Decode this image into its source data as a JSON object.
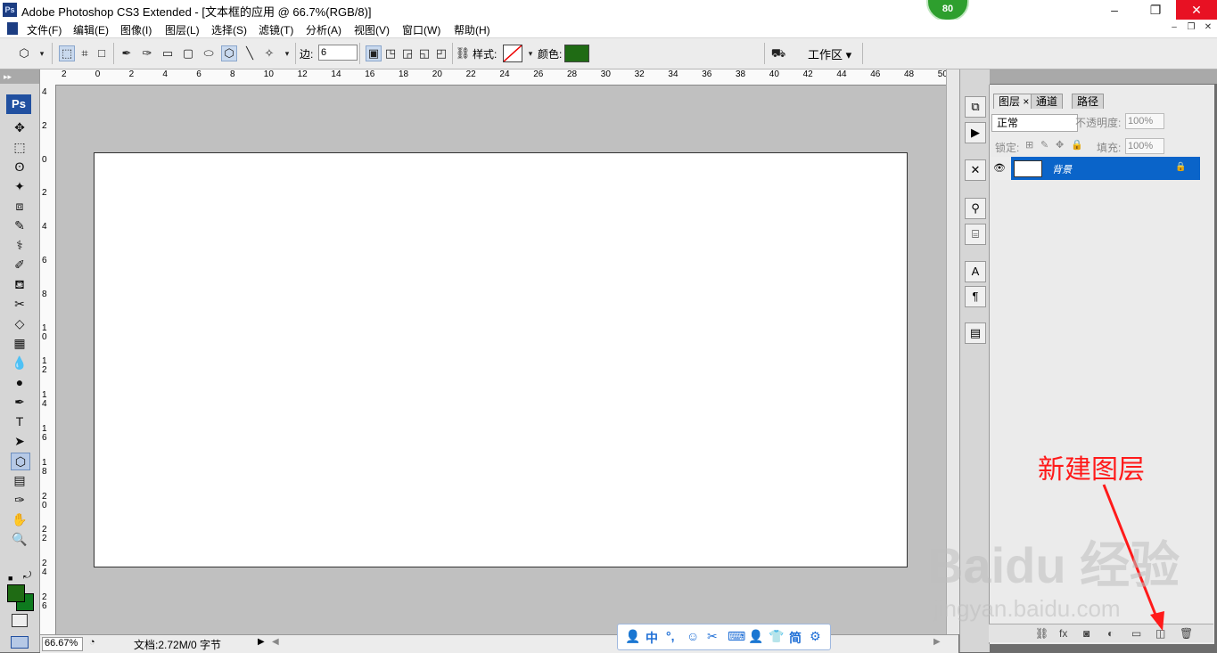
{
  "window": {
    "app_icon": "Ps",
    "title": "Adobe Photoshop CS3 Extended - [文本框的应用 @ 66.7%(RGB/8)]",
    "badge": "80",
    "min_icon": "–",
    "max_icon": "❐",
    "close_icon": "✕"
  },
  "menu": {
    "items": [
      "文件(F)",
      "编辑(E)",
      "图像(I)",
      "图层(L)",
      "选择(S)",
      "滤镜(T)",
      "分析(A)",
      "视图(V)",
      "窗口(W)",
      "帮助(H)"
    ],
    "doc_controls": [
      "–",
      "❐",
      "✕"
    ]
  },
  "options": {
    "sides_label": "边:",
    "sides_value": "6",
    "style_label": "样式:",
    "color_label": "颜色:",
    "color_value": "#1f6b14",
    "workspace_label": "工作区 ▾"
  },
  "toolbox": {
    "header": "▸▸",
    "logo": "Ps",
    "tools": [
      "✥",
      "⬚",
      "ʘ",
      "✦",
      "⧈",
      "✎",
      "⚕",
      "✐",
      "⛾",
      "✂",
      "◇",
      "▦",
      "💧",
      "●",
      "✒",
      "T",
      "➤",
      "⬡",
      "▤",
      "✑",
      "✋",
      "🔍"
    ],
    "fg_color": "#1f6b14",
    "bg_color": "#0e7a1e"
  },
  "rulers": {
    "h_labels": [
      "2",
      "0",
      "2",
      "4",
      "6",
      "8",
      "10",
      "12",
      "14",
      "16",
      "18",
      "20",
      "22",
      "24",
      "26",
      "28",
      "30",
      "32",
      "34",
      "36",
      "38",
      "40",
      "42",
      "44",
      "46",
      "48",
      "50"
    ],
    "v_labels": [
      "4",
      "2",
      "0",
      "2",
      "4",
      "6",
      "8",
      "10",
      "12",
      "14",
      "16",
      "18",
      "20",
      "22",
      "24",
      "26"
    ]
  },
  "status": {
    "zoom": "66.67%",
    "doc_info": "文档:2.72M/0 字节"
  },
  "ime": {
    "items": [
      "👤",
      "中",
      "°,",
      "☺",
      "✂",
      "⌨",
      "👤",
      "👕",
      "简",
      "⚙"
    ]
  },
  "dock": {
    "icons": [
      "⧉",
      "▶",
      "✕",
      "⚲",
      "⌸",
      "A",
      "¶",
      "▤"
    ]
  },
  "layers": {
    "tabs": [
      "图层 ×",
      "通道",
      "路径"
    ],
    "blend_mode": "正常",
    "opacity_label": "不透明度:",
    "opacity_value": "100%",
    "lock_label": "锁定:",
    "fill_label": "填充:",
    "fill_value": "100%",
    "layer_name": "背景",
    "footer_icons": [
      "⛓",
      "fx",
      "◙",
      "◐",
      "▭",
      "◫",
      "🗑"
    ]
  },
  "annotation": {
    "label": "新建图层",
    "color": "#ff1a1a"
  },
  "watermark": {
    "main": "Baidu 经验",
    "sub": "jingyan.baidu.com"
  }
}
